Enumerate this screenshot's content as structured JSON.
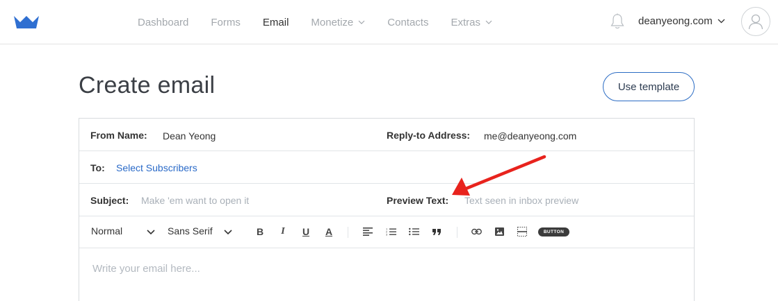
{
  "nav": {
    "items": [
      {
        "label": "Dashboard",
        "active": false,
        "has_dropdown": false
      },
      {
        "label": "Forms",
        "active": false,
        "has_dropdown": false
      },
      {
        "label": "Email",
        "active": true,
        "has_dropdown": false
      },
      {
        "label": "Monetize",
        "active": false,
        "has_dropdown": true
      },
      {
        "label": "Contacts",
        "active": false,
        "has_dropdown": false
      },
      {
        "label": "Extras",
        "active": false,
        "has_dropdown": true
      }
    ],
    "account_name": "deanyeong.com"
  },
  "page": {
    "title": "Create email",
    "use_template_label": "Use template"
  },
  "form": {
    "from_name_label": "From Name:",
    "from_name_value": "Dean Yeong",
    "reply_to_label": "Reply-to Address:",
    "reply_to_value": "me@deanyeong.com",
    "to_label": "To:",
    "to_link": "Select Subscribers",
    "subject_label": "Subject:",
    "subject_placeholder": "Make 'em want to open it",
    "preview_label": "Preview Text:",
    "preview_placeholder": "Text seen in inbox preview"
  },
  "toolbar": {
    "format_value": "Normal",
    "font_value": "Sans Serif",
    "bold": "B",
    "italic": "I",
    "underline": "U",
    "color": "A",
    "button_label": "BUTTON"
  },
  "editor": {
    "placeholder": "Write your email here..."
  },
  "icons": {
    "logo": "crown-logo-icon",
    "bell": "bell-icon",
    "avatar": "user-avatar-icon",
    "align": "align-left-icon",
    "ordered_list": "ordered-list-icon",
    "bullet_list": "bullet-list-icon",
    "quote": "quote-icon",
    "link": "link-icon",
    "image": "image-icon",
    "divider": "divider-icon"
  },
  "colors": {
    "brand": "#2b6cc4",
    "link": "#2a6ac8",
    "annotation_arrow": "#e8231d",
    "nav_inactive": "#a3a8ad"
  }
}
